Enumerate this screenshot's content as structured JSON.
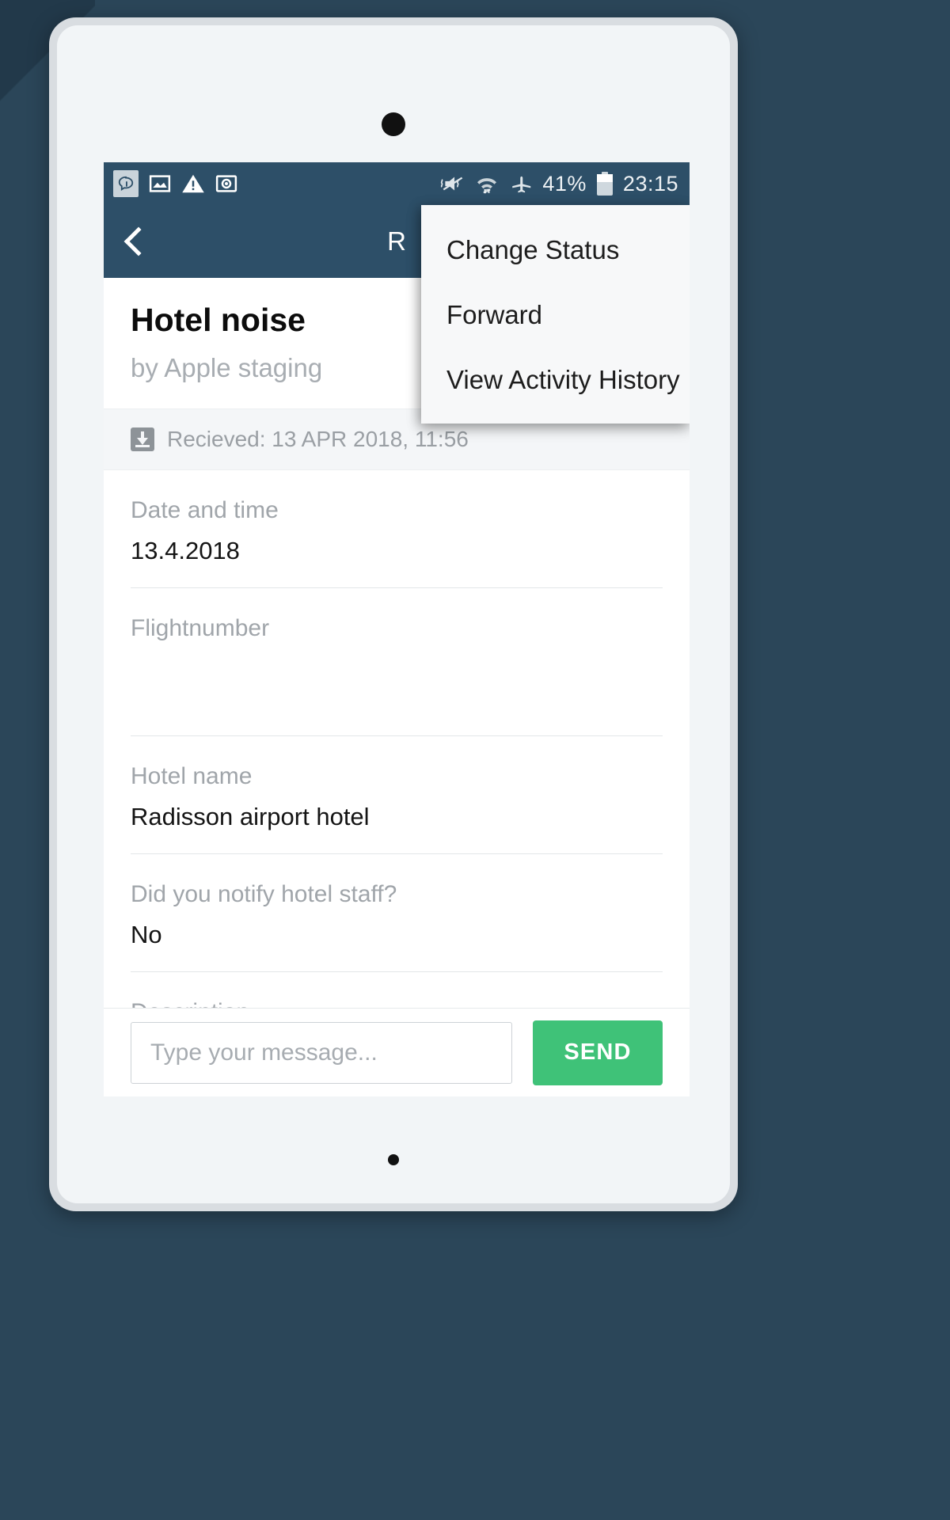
{
  "statusbar": {
    "icons_left": [
      "chat-bubble-icon",
      "image-icon",
      "warning-icon",
      "screenshot-icon"
    ],
    "icons_right": [
      "vibrate-mute-icon",
      "wifi-icon",
      "airplane-mode-icon"
    ],
    "battery_percent": "41%",
    "time": "23:15",
    "background": "#2d4f68"
  },
  "appbar": {
    "back_label": "back-chevron",
    "title": "R",
    "background": "#2d4f68"
  },
  "popup_menu": {
    "items": [
      {
        "label": "Change Status"
      },
      {
        "label": "Forward"
      },
      {
        "label": "View Activity History"
      }
    ]
  },
  "ticket": {
    "title": "Hotel noise",
    "submitted_by": "by Apple staging",
    "received": "Recieved: 13 APR 2018, 11:56"
  },
  "form": {
    "fields": [
      {
        "label": "Date and time",
        "value": "13.4.2018"
      },
      {
        "label": "Flightnumber",
        "value": ""
      },
      {
        "label": "Hotel name",
        "value": "Radisson airport hotel"
      },
      {
        "label": "Did you notify hotel staff?",
        "value": "No"
      },
      {
        "label": "Description",
        "value": ""
      }
    ]
  },
  "message_bar": {
    "placeholder": "Type your message...",
    "input_value": "",
    "send_label": "SEND",
    "send_color": "#3fc278"
  }
}
